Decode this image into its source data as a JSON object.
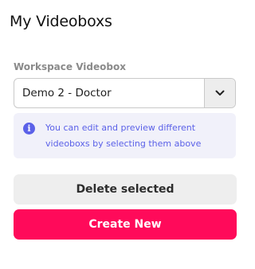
{
  "panel": {
    "title": "My Videoboxs"
  },
  "workspace_select": {
    "label": "Workspace Videobox",
    "selected_value": "Demo 2 - Doctor",
    "arrow_icon": "chevron-down-icon"
  },
  "info": {
    "icon": "info-icon",
    "icon_glyph": "i",
    "text": "You can edit and preview different videoboxs by selecting them above",
    "color": "#5b61e8"
  },
  "actions": {
    "delete_label": "Delete selected",
    "create_label": "Create New",
    "create_color": "#ff0a5a"
  }
}
